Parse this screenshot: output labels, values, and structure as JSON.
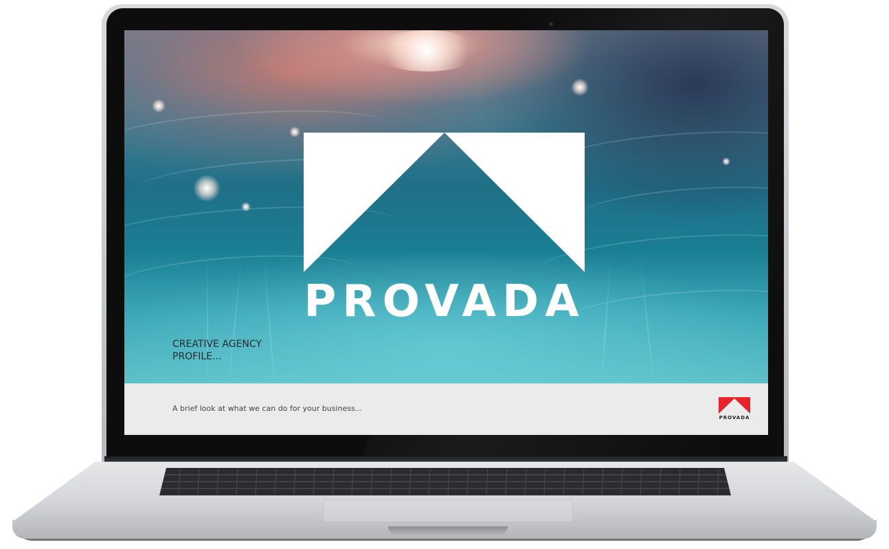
{
  "slide": {
    "brand_name": "PROVADA",
    "tagline_line1": "CREATIVE AGENCY",
    "tagline_line2": "PROFILE...",
    "footer_text": "A brief look at what we can do for your business...",
    "footer_logo_text": "PROVADA"
  },
  "colors": {
    "logo_white": "#ffffff",
    "brand_red": "#e8232a",
    "footer_bg": "#ebebeb",
    "tagline_text": "#1e2c33",
    "footer_text": "#444444"
  },
  "icons": {
    "main_logo": "provada-mountain-logo",
    "footer_logo": "provada-red-mountain-logo",
    "camera": "webcam-dot"
  }
}
